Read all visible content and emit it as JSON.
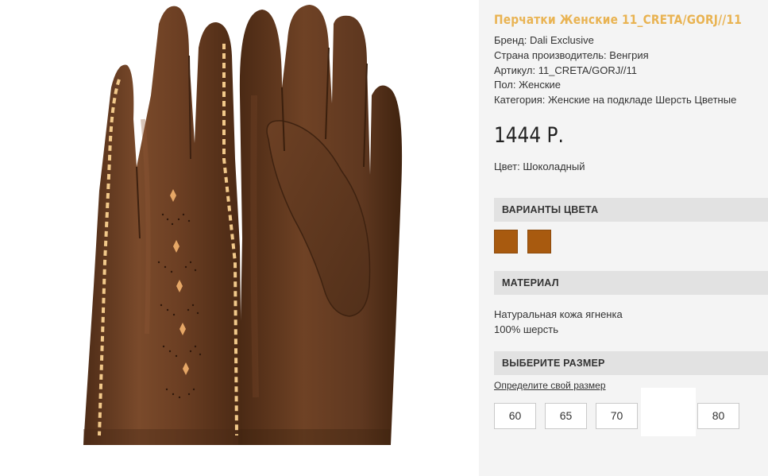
{
  "product": {
    "title": "Перчатки Женские 11_CRETA/GORJ//11",
    "brand": "Бренд: Dali Exclusive",
    "country": "Страна производитель: Венгрия",
    "article": "Артикул: 11_CRETA/GORJ//11",
    "gender": "Пол: Женские",
    "category": "Категория: Женские на подкладе Шерсть Цветные",
    "price": "1444 Р.",
    "color": "Цвет: Шоколадный"
  },
  "color_variants": {
    "heading": "ВАРИАНТЫ ЦВЕТА",
    "swatches": [
      "#a85a0f",
      "#a85a0f"
    ]
  },
  "material": {
    "heading": "МАТЕРИАЛ",
    "line1": "Натуральная кожа ягненка",
    "line2": "100% шерсть"
  },
  "size": {
    "heading": "ВЫБЕРИТЕ РАЗМЕР",
    "link": "Определите свой размер",
    "options": [
      "60",
      "65",
      "70",
      "80"
    ]
  },
  "colors": {
    "title_accent": "#e9b352",
    "leather": "#6b3f24",
    "stitching": "#f2c98a",
    "swatch": "#a85a0f"
  }
}
